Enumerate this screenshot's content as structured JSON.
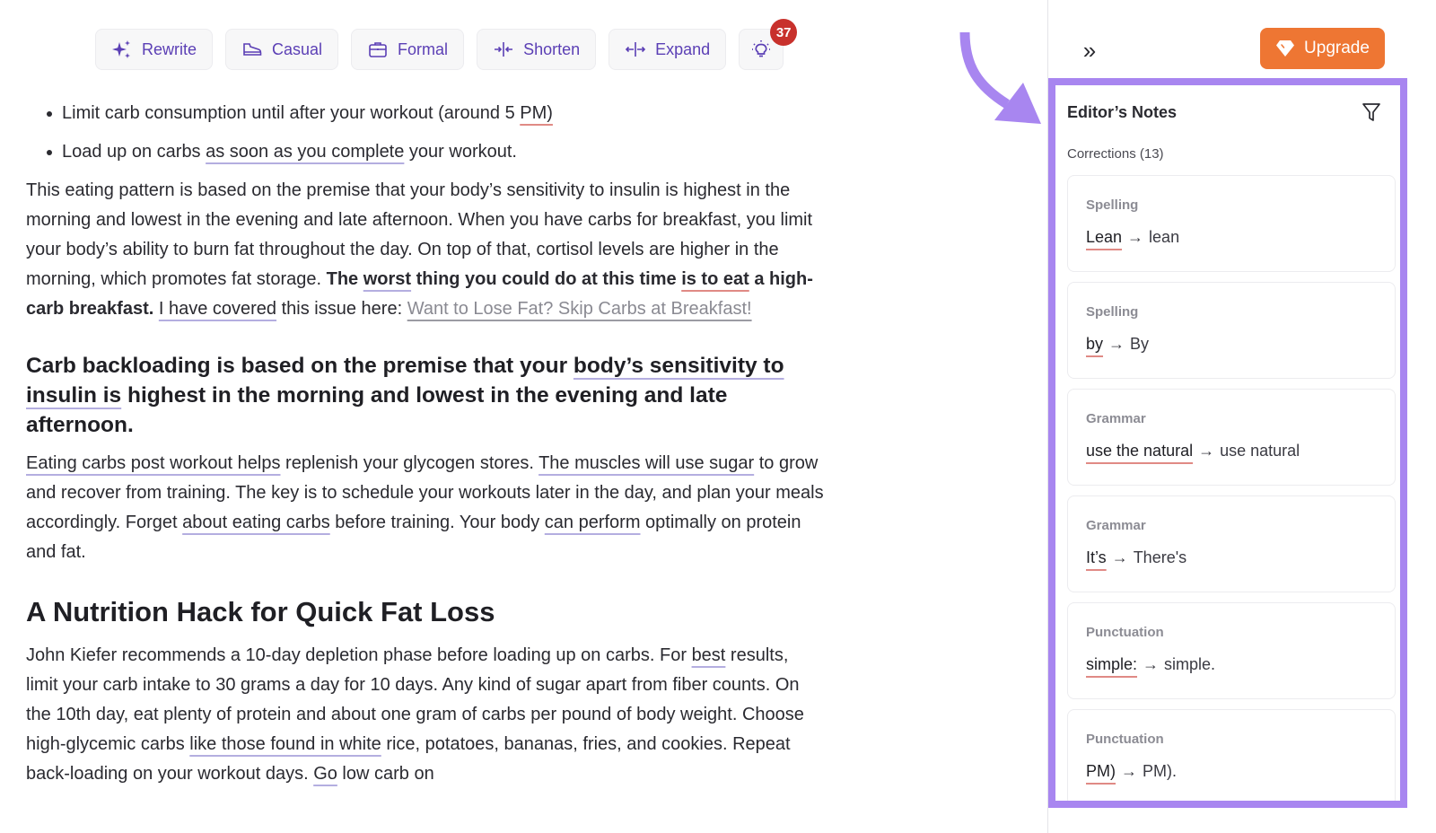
{
  "toolbar": {
    "buttons": [
      {
        "label": "Rewrite",
        "icon": "sparkles-icon"
      },
      {
        "label": "Casual",
        "icon": "sneaker-icon"
      },
      {
        "label": "Formal",
        "icon": "briefcase-icon"
      },
      {
        "label": "Shorten",
        "icon": "shorten-icon"
      },
      {
        "label": "Expand",
        "icon": "expand-icon"
      }
    ],
    "ideas": {
      "icon": "lightbulb-icon",
      "badge": "37"
    }
  },
  "document": {
    "bullets": [
      {
        "pre": "Limit carb consumption until after your workout (around 5 ",
        "mark": "PM)",
        "post": ""
      },
      {
        "pre": "Load up on carbs ",
        "mark": "as soon as you complete",
        "post": " your workout."
      }
    ],
    "para1": {
      "text": "This eating pattern is based on the premise that your body’s sensitivity to insulin is highest in the morning and lowest in the evening and late afternoon. When you have carbs for breakfast, you limit your body’s ability to burn fat throughout the day. On top of that, cortisol levels are higher in the morning, which promotes fat storage. ",
      "bold_a": "The ",
      "bold_mark1": "worst",
      "bold_b": " thing you could do at this time ",
      "bold_mark2": "is to eat",
      "bold_c": " a high-carb breakfast.",
      "mid_mark": "I have covered",
      "mid_post": " this issue here: ",
      "link": "Want to Lose Fat? Skip Carbs at Breakfast!"
    },
    "heading1": {
      "pre": "Carb backloading is based on the premise that your ",
      "mark": "body’s sensitivity to insulin is",
      "post": " highest in the morning and lowest in the evening and late afternoon."
    },
    "para2": {
      "mark1": "Eating carbs post workout helps",
      "t1": " replenish your glycogen stores. ",
      "mark2": "The muscles will use sugar",
      "t2": " to grow and recover from training. The key is to schedule your workouts later in the day, and plan your meals accordingly. Forget ",
      "mark3": "about eating carbs",
      "t3": " before training. Your body ",
      "mark4": "can perform",
      "t4": " optimally on protein and fat."
    },
    "heading2": "A Nutrition Hack for Quick Fat Loss",
    "para3": {
      "t1": "John Kiefer recommends a 10-day depletion phase before loading up on carbs. For ",
      "mark1": "best",
      "t2": " results, limit your carb intake to 30 grams a day for 10 days. Any kind of sugar apart from fiber counts. On the 10th day, eat plenty of protein and about one gram of carbs per pound of body weight. Choose high-glycemic carbs ",
      "mark2": "like those found in white",
      "t3": " rice, potatoes, bananas, fries, and cookies. Repeat back-loading on your workout days. ",
      "mark3": "Go",
      "t4": " low carb on"
    }
  },
  "sidebar": {
    "collapse_label": "»",
    "upgrade_label": "Upgrade",
    "notes_title": "Editor’s Notes",
    "corrections_label": "Corrections (13)",
    "cards": [
      {
        "type": "Spelling",
        "from": "Lean",
        "to": "lean"
      },
      {
        "type": "Spelling",
        "from": "by",
        "to": "By"
      },
      {
        "type": "Grammar",
        "from": "use the natural",
        "to": "use natural"
      },
      {
        "type": "Grammar",
        "from": "It’s",
        "to": "There's"
      },
      {
        "type": "Punctuation",
        "from": "simple:",
        "to": "simple."
      },
      {
        "type": "Punctuation",
        "from": "PM)",
        "to": "PM)."
      }
    ],
    "arrow_glyph": "→"
  },
  "colors": {
    "accent_purple": "#5b3fb5",
    "highlight_frame": "#a886f0",
    "upgrade_orange": "#ee7633",
    "badge_red": "#c8312c",
    "underline_red": "#e08a85",
    "underline_purple": "#b4aee0"
  }
}
